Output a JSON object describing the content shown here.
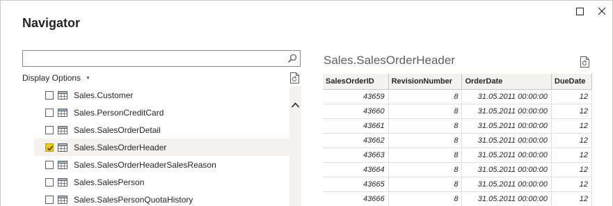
{
  "window": {
    "title": "Navigator",
    "maximize_icon": "maximize-icon",
    "close_icon": "close-icon"
  },
  "navigator": {
    "search": {
      "value": "",
      "placeholder": ""
    },
    "display_options_label": "Display Options",
    "items": [
      {
        "label": "Sales.Customer",
        "checked": false,
        "selected": false
      },
      {
        "label": "Sales.PersonCreditCard",
        "checked": false,
        "selected": false
      },
      {
        "label": "Sales.SalesOrderDetail",
        "checked": false,
        "selected": false
      },
      {
        "label": "Sales.SalesOrderHeader",
        "checked": true,
        "selected": true
      },
      {
        "label": "Sales.SalesOrderHeaderSalesReason",
        "checked": false,
        "selected": false
      },
      {
        "label": "Sales.SalesPerson",
        "checked": false,
        "selected": false
      },
      {
        "label": "Sales.SalesPersonQuotaHistory",
        "checked": false,
        "selected": false
      }
    ]
  },
  "preview": {
    "title": "Sales.SalesOrderHeader",
    "columns": [
      "SalesOrderID",
      "RevisionNumber",
      "OrderDate",
      "DueDate"
    ],
    "rows": [
      [
        "43659",
        "8",
        "31.05.2011 00:00:00",
        "12"
      ],
      [
        "43660",
        "8",
        "31.05.2011 00:00:00",
        "12"
      ],
      [
        "43661",
        "8",
        "31.05.2011 00:00:00",
        "12"
      ],
      [
        "43662",
        "8",
        "31.05.2011 00:00:00",
        "12"
      ],
      [
        "43663",
        "8",
        "31.05.2011 00:00:00",
        "12"
      ],
      [
        "43664",
        "8",
        "31.05.2011 00:00:00",
        "12"
      ],
      [
        "43665",
        "8",
        "31.05.2011 00:00:00",
        "12"
      ],
      [
        "43666",
        "8",
        "31.05.2011 00:00:00",
        "12"
      ]
    ]
  },
  "colors": {
    "checked_fill": "#f2c811",
    "selected_row": "#f3f2f1",
    "header_bg": "#f3f2f1"
  }
}
